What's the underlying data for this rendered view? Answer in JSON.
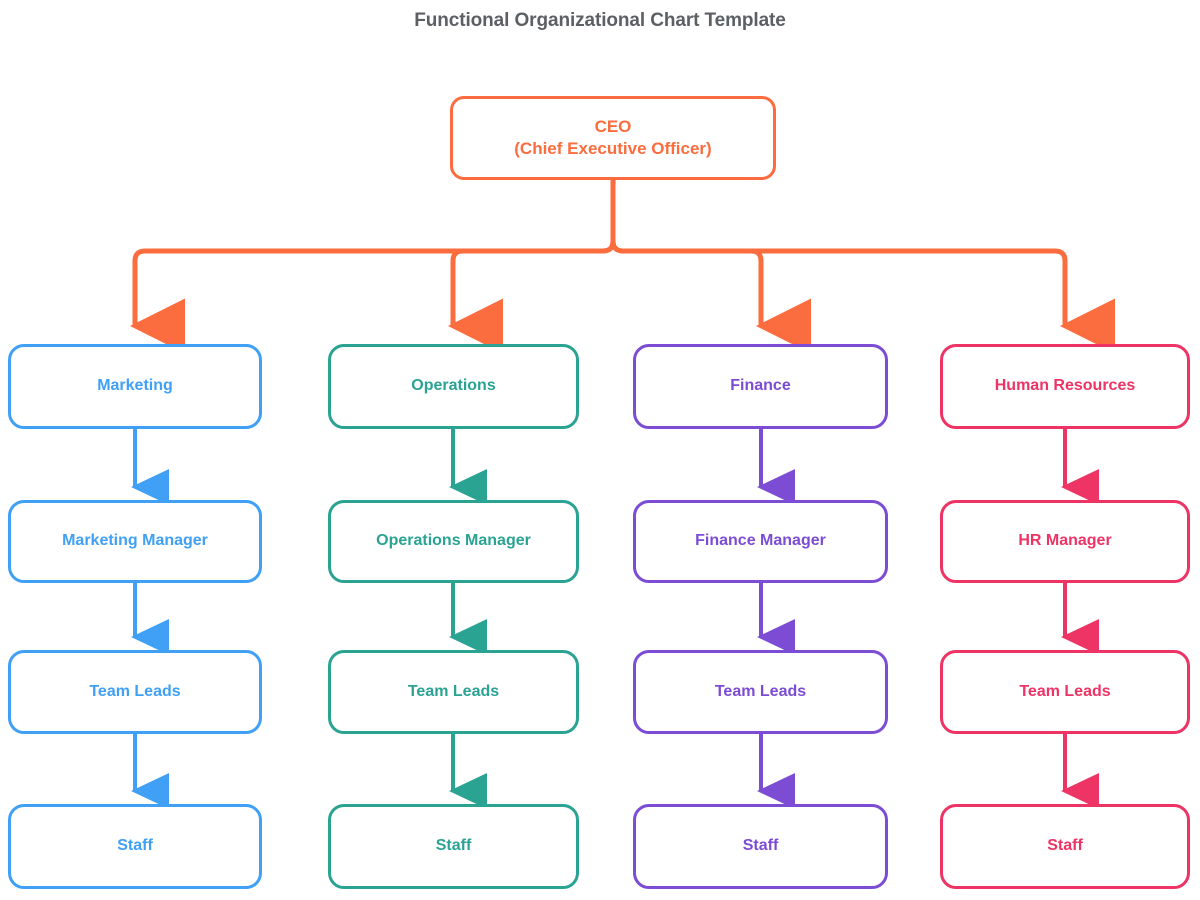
{
  "title": "Functional Organizational Chart Template",
  "title_color": "#5c6065",
  "background": "#ffffff",
  "root": {
    "line1": "CEO",
    "line2": "(Chief Executive Officer)",
    "color": "#fb6c3e"
  },
  "connector": {
    "root_bus_color": "#fb6c3e",
    "arrow_style": "solid-arrowhead-down"
  },
  "columns": [
    {
      "id": "marketing",
      "color": "#3fa0f5",
      "levels": [
        {
          "label": "Marketing"
        },
        {
          "label": "Marketing Manager"
        },
        {
          "label": "Team Leads"
        },
        {
          "label": "Staff"
        }
      ]
    },
    {
      "id": "operations",
      "color": "#2aa393",
      "levels": [
        {
          "label": "Operations"
        },
        {
          "label": "Operations Manager"
        },
        {
          "label": "Team Leads"
        },
        {
          "label": "Staff"
        }
      ]
    },
    {
      "id": "finance",
      "color": "#7c4dd4",
      "levels": [
        {
          "label": "Finance"
        },
        {
          "label": "Finance Manager"
        },
        {
          "label": "Team Leads"
        },
        {
          "label": "Staff"
        }
      ]
    },
    {
      "id": "human-resources",
      "color": "#ee3365",
      "levels": [
        {
          "label": "Human Resources"
        },
        {
          "label": "HR Manager"
        },
        {
          "label": "Team Leads"
        },
        {
          "label": "Staff"
        }
      ]
    }
  ]
}
